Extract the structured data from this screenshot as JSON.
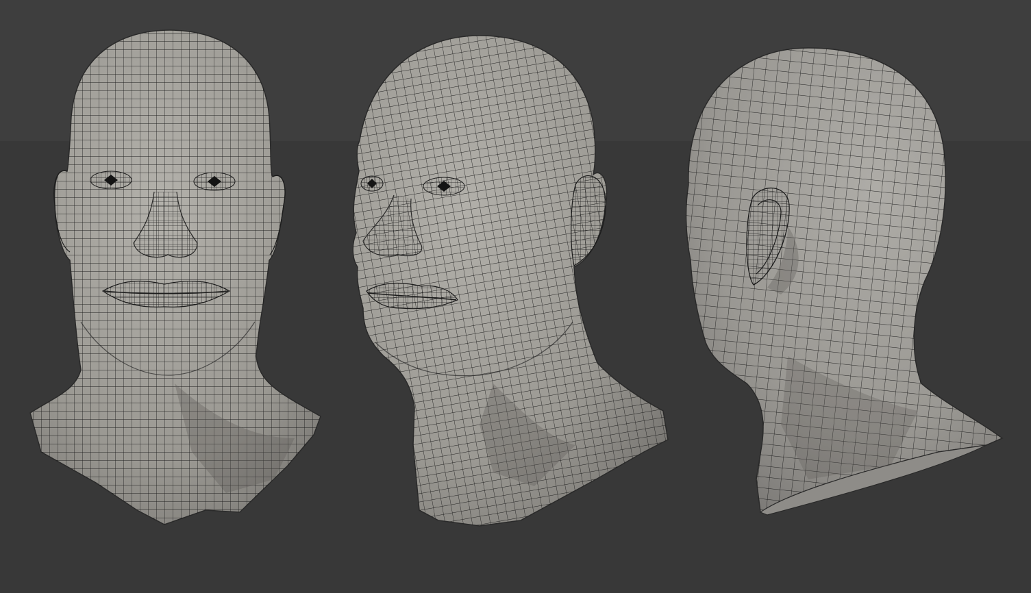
{
  "scene": {
    "background_color": "#3a3a3a",
    "mesh_color": "#9c9a94",
    "wire_color": "#1b1b1b",
    "views": [
      {
        "name": "front-view"
      },
      {
        "name": "three-quarter-view"
      },
      {
        "name": "rear-three-quarter-view"
      }
    ]
  }
}
